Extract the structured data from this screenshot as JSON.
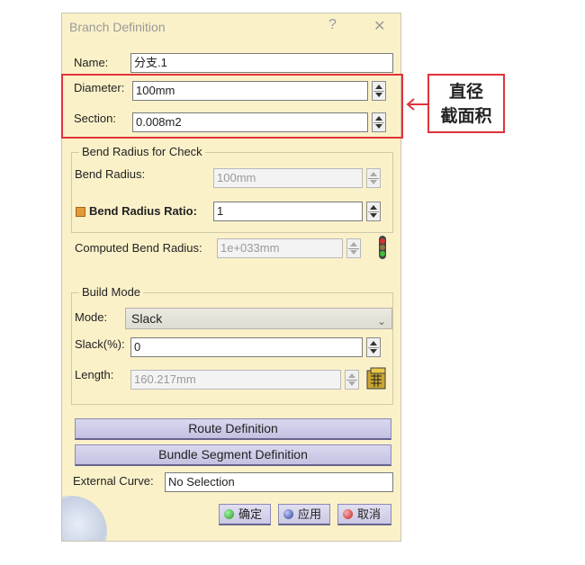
{
  "dialog": {
    "title": "Branch Definition",
    "help_label": "?",
    "close_label": "✕"
  },
  "name": {
    "label": "Name:",
    "value": "分支.1"
  },
  "diameter": {
    "label": "Diameter:",
    "value": "100mm"
  },
  "section": {
    "label": "Section:",
    "value": "0.008m2"
  },
  "bend_group": {
    "title": "Bend Radius for Check",
    "bend_radius": {
      "label": "Bend Radius:",
      "value": "100mm"
    },
    "bend_radius_ratio": {
      "label": "Bend Radius Ratio:",
      "value": "1"
    }
  },
  "computed_bend_radius": {
    "label": "Computed Bend Radius:",
    "value": "1e+033mm"
  },
  "build_group": {
    "title": "Build Mode",
    "mode": {
      "label": "Mode:",
      "value": "Slack"
    },
    "slack": {
      "label": "Slack(%):",
      "value": "0"
    },
    "length": {
      "label": "Length:",
      "value": "160.217mm"
    }
  },
  "buttons": {
    "route_definition": "Route Definition",
    "bundle_segment_definition": "Bundle Segment Definition",
    "ok": "确定",
    "apply": "应用",
    "cancel": "取消"
  },
  "external_curve": {
    "label": "External Curve:",
    "value": "No Selection"
  },
  "annotation": {
    "line1": "直径",
    "line2": "截面积",
    "color": "#e0333a"
  },
  "colors": {
    "dialog_bg": "#fbf1c9",
    "button_bg": "#c9c7e4"
  }
}
